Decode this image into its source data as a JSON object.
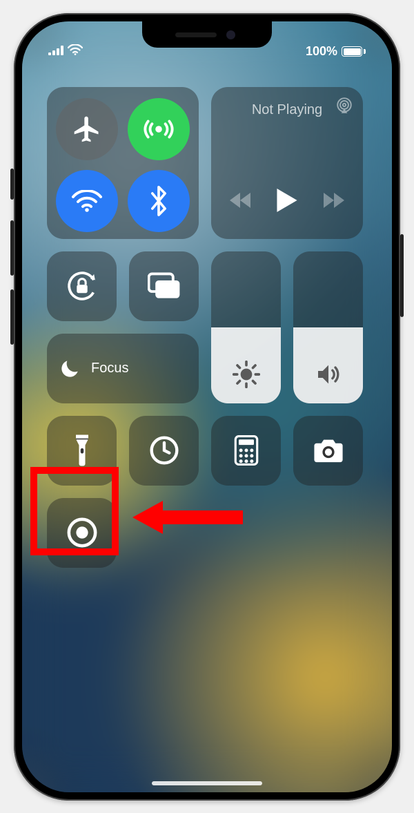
{
  "status": {
    "battery_pct": "100%"
  },
  "media": {
    "title": "Not Playing"
  },
  "focus": {
    "label": "Focus"
  },
  "icons": {
    "airplane": "airplane-icon",
    "cellular": "antenna-icon",
    "wifi": "wifi-icon",
    "bluetooth": "bluetooth-icon",
    "airplay": "airplay-icon",
    "prev": "prev-track-icon",
    "play": "play-icon",
    "next": "next-track-icon",
    "rotation_lock": "rotation-lock-icon",
    "mirroring": "screen-mirroring-icon",
    "moon": "moon-icon",
    "brightness": "brightness-icon",
    "volume": "volume-icon",
    "flashlight": "flashlight-icon",
    "timer": "timer-icon",
    "calculator": "calculator-icon",
    "camera": "camera-icon",
    "record": "screen-record-icon"
  },
  "annotation": {
    "target": "screen-record-button",
    "color": "#ff0000"
  }
}
